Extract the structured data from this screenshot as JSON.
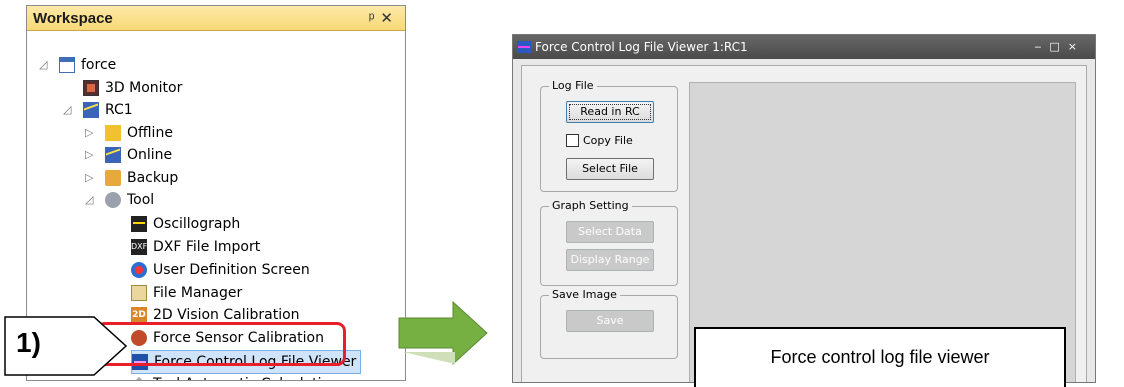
{
  "workspace": {
    "title": "Workspace",
    "pin_glyph": "ᵖ",
    "close_glyph": "✕",
    "tree": [
      {
        "label": "force",
        "icon": "project-icon",
        "expanded": true
      },
      {
        "label": "3D Monitor",
        "icon": "3d-monitor-icon"
      },
      {
        "label": "RC1",
        "icon": "robot-controller-icon",
        "expanded": true
      },
      {
        "label": "Offline",
        "icon": "offline-icon",
        "expanded": false
      },
      {
        "label": "Online",
        "icon": "online-icon",
        "expanded": false
      },
      {
        "label": "Backup",
        "icon": "backup-icon",
        "expanded": false
      },
      {
        "label": "Tool",
        "icon": "tool-icon",
        "expanded": true
      },
      {
        "label": "Oscillograph",
        "icon": "oscillograph-icon"
      },
      {
        "label": "DXF File Import",
        "icon": "dxf-icon"
      },
      {
        "label": "User Definition Screen",
        "icon": "user-definition-icon"
      },
      {
        "label": "File Manager",
        "icon": "file-manager-icon"
      },
      {
        "label": "2D Vision Calibration",
        "icon": "2d-vision-icon"
      },
      {
        "label": "Force Sensor Calibration",
        "icon": "force-sensor-icon"
      },
      {
        "label": "Force Control Log File Viewer",
        "icon": "force-log-viewer-icon",
        "selected": true
      },
      {
        "label": "Tool Automatic Calculation",
        "icon": "tool-calc-icon"
      }
    ]
  },
  "callout": {
    "label": "1)"
  },
  "viewer": {
    "title": "Force Control Log File Viewer 1:RC1",
    "log_file_group": "Log File",
    "read_in_rc": "Read in RC",
    "copy_file": "Copy File",
    "select_file": "Select File",
    "graph_setting_group": "Graph Setting",
    "select_data": "Select Data",
    "display_range": "Display Range",
    "save_image_group": "Save Image",
    "save": "Save"
  },
  "annotation": {
    "caption": "Force control log file viewer"
  },
  "colors": {
    "highlight": "#e8202a",
    "arrow": "#76b043",
    "selection": "#cfe3fb"
  }
}
